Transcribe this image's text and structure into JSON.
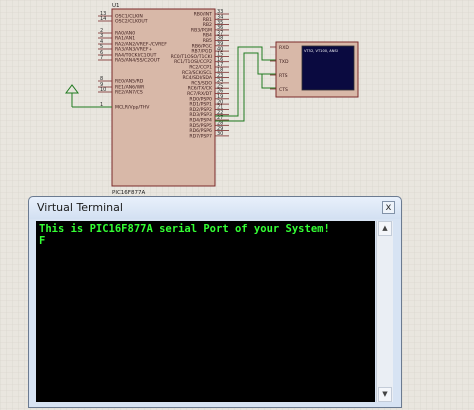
{
  "chip": {
    "ref": "U1",
    "part": "PIC16F877A",
    "left_pins": [
      {
        "num": "13",
        "label": "OSC1/CLKIN"
      },
      {
        "num": "14",
        "label": "OSC2/CLKOUT"
      },
      {
        "num": "2",
        "label": "RA0/AN0"
      },
      {
        "num": "3",
        "label": "RA1/AN1"
      },
      {
        "num": "4",
        "label": "RA2/AN2/VREF-/CVREF"
      },
      {
        "num": "5",
        "label": "RA3/AN3/VREF+"
      },
      {
        "num": "6",
        "label": "RA4/T0CKI/C1OUT"
      },
      {
        "num": "7",
        "label": "RA5/AN4/SS/C2OUT"
      },
      {
        "num": "8",
        "label": "RE0/AN5/RD"
      },
      {
        "num": "9",
        "label": "RE1/AN6/WR"
      },
      {
        "num": "10",
        "label": "RE2/AN7/CS"
      },
      {
        "num": "1",
        "label": "MCLR/Vpp/THV"
      }
    ],
    "right_pins": [
      {
        "num": "33",
        "label": "RB0/INT"
      },
      {
        "num": "34",
        "label": "RB1"
      },
      {
        "num": "35",
        "label": "RB2"
      },
      {
        "num": "36",
        "label": "RB3/PGM"
      },
      {
        "num": "37",
        "label": "RB4"
      },
      {
        "num": "38",
        "label": "RB5"
      },
      {
        "num": "39",
        "label": "RB6/PGC"
      },
      {
        "num": "40",
        "label": "RB7/PGD"
      },
      {
        "num": "15",
        "label": "RC0/T1OSO/T1CKI"
      },
      {
        "num": "16",
        "label": "RC1/T1OSI/CCP2"
      },
      {
        "num": "17",
        "label": "RC2/CCP1"
      },
      {
        "num": "18",
        "label": "RC3/SCK/SCL"
      },
      {
        "num": "23",
        "label": "RC4/SDI/SDA"
      },
      {
        "num": "24",
        "label": "RC5/SDO"
      },
      {
        "num": "25",
        "label": "RC6/TX/CK"
      },
      {
        "num": "26",
        "label": "RC7/RX/DT"
      },
      {
        "num": "19",
        "label": "RD0/PSP0"
      },
      {
        "num": "20",
        "label": "RD1/PSP1"
      },
      {
        "num": "21",
        "label": "RD2/PSP2"
      },
      {
        "num": "22",
        "label": "RD3/PSP3"
      },
      {
        "num": "27",
        "label": "RD4/PSP4"
      },
      {
        "num": "28",
        "label": "RD5/PSP5"
      },
      {
        "num": "29",
        "label": "RD6/PSP6"
      },
      {
        "num": "30",
        "label": "RD7/PSP7"
      }
    ]
  },
  "terminal_component": {
    "pins": [
      "RXD",
      "TXD",
      "RTS",
      "CTS"
    ],
    "screen_text": "VT52, VT100, ANSI"
  },
  "colors": {
    "grid_bg": "#e9e6df",
    "chip_fill": "#d8b8a8",
    "wire": "#1f7a1f",
    "terminal_text": "#34ff34"
  },
  "window": {
    "title": "Virtual Terminal",
    "close_glyph": "x",
    "lines": [
      "This is PIC16F877A serial Port of your System!",
      "F"
    ]
  }
}
